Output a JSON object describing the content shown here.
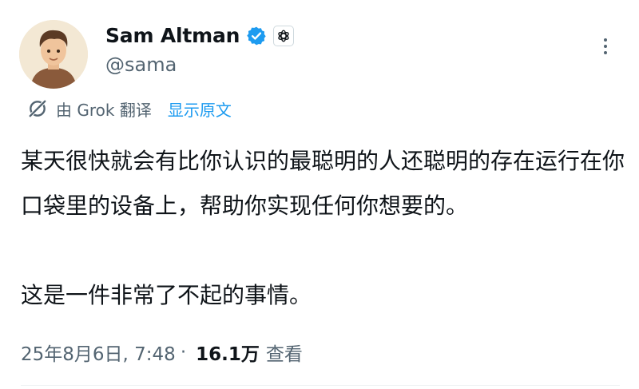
{
  "author": {
    "display_name": "Sam Altman",
    "handle": "@sama",
    "verified_color": "#1d9bf0"
  },
  "translation": {
    "label": "由 Grok 翻译",
    "show_original": "显示原文",
    "icon": "grok-icon"
  },
  "tweet": {
    "paragraph1": "某天很快就会有比你认识的最聪明的人还聪明的存在运行在你口袋里的设备上，帮助你实现任何你想要的。",
    "paragraph2": "这是一件非常了不起的事情。"
  },
  "meta": {
    "timestamp": "25年8月6日, 7:48",
    "separator": "·",
    "views_count": "16.1万",
    "views_label": "查看"
  },
  "colors": {
    "accent": "#1d9bf0",
    "secondary_text": "#536471",
    "primary_text": "#0f1419"
  }
}
